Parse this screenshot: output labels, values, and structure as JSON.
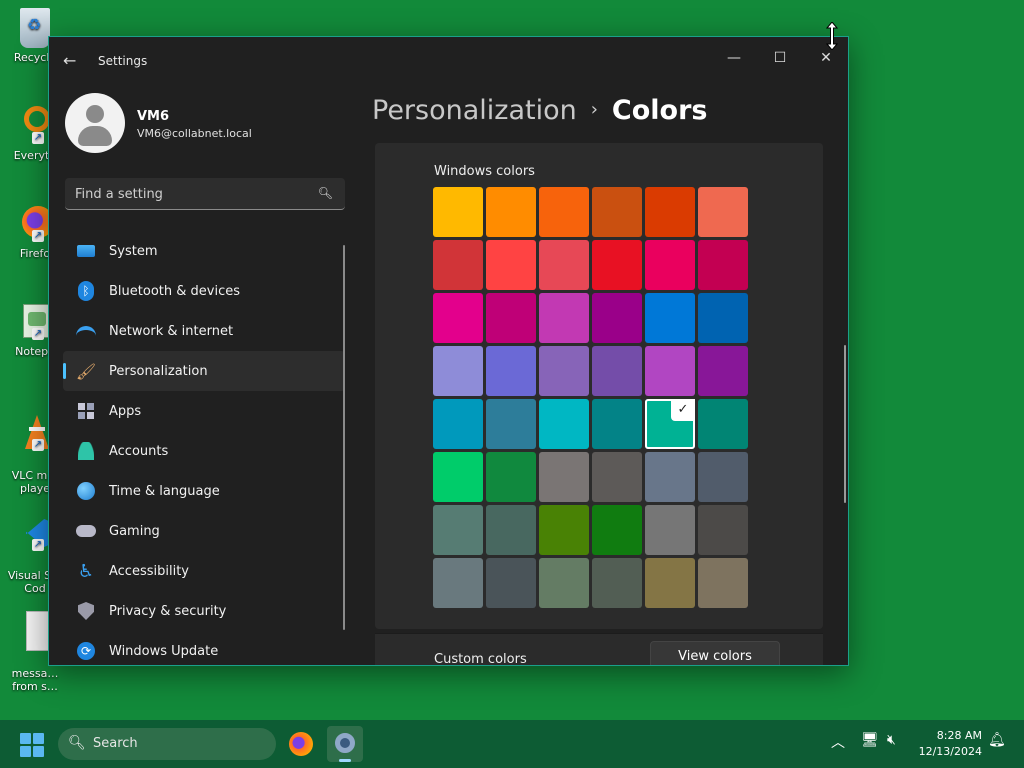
{
  "desktop": {
    "icons": [
      {
        "label": "Recycle"
      },
      {
        "label": "Everyth"
      },
      {
        "label": "Firefo"
      },
      {
        "label": "Notepa"
      },
      {
        "label": "VLC m…\nplaye"
      },
      {
        "label": "Visual S…\nCod"
      },
      {
        "label": "messa…\nfrom s…"
      }
    ]
  },
  "window": {
    "title": "Settings",
    "controls": {
      "minimize": "—",
      "maximize": "☐",
      "close": "✕"
    },
    "profile": {
      "name": "VM6",
      "email": "VM6@collabnet.local"
    },
    "search": {
      "placeholder": "Find a setting"
    },
    "nav": [
      {
        "label": "System",
        "icon": "system-icon"
      },
      {
        "label": "Bluetooth & devices",
        "icon": "bluetooth-icon"
      },
      {
        "label": "Network & internet",
        "icon": "wifi-icon"
      },
      {
        "label": "Personalization",
        "icon": "brush-icon",
        "active": true
      },
      {
        "label": "Apps",
        "icon": "apps-icon"
      },
      {
        "label": "Accounts",
        "icon": "accounts-icon"
      },
      {
        "label": "Time & language",
        "icon": "globe-icon"
      },
      {
        "label": "Gaming",
        "icon": "gamepad-icon"
      },
      {
        "label": "Accessibility",
        "icon": "accessibility-icon"
      },
      {
        "label": "Privacy & security",
        "icon": "shield-icon"
      },
      {
        "label": "Windows Update",
        "icon": "update-icon"
      }
    ],
    "breadcrumb": {
      "parent": "Personalization",
      "separator": "›",
      "current": "Colors"
    },
    "windows_colors": {
      "title": "Windows colors",
      "selected_index": 28,
      "swatches": [
        "#ffb900",
        "#ff8c00",
        "#f7630c",
        "#ca5010",
        "#da3b01",
        "#ef6950",
        "#d13438",
        "#ff4343",
        "#e74856",
        "#e81123",
        "#ea005e",
        "#c30052",
        "#e3008c",
        "#bf0077",
        "#c239b3",
        "#9a0089",
        "#0078d7",
        "#0063b1",
        "#8e8cd8",
        "#6b69d6",
        "#8764b8",
        "#744da9",
        "#b146c2",
        "#881798",
        "#0099bc",
        "#2d7d9a",
        "#00b7c3",
        "#038387",
        "#00b294",
        "#018574",
        "#00cc6a",
        "#10893e",
        "#7a7574",
        "#5d5a58",
        "#68768a",
        "#515c6b",
        "#567c73",
        "#486860",
        "#498205",
        "#107c10",
        "#767676",
        "#4c4a48",
        "#69797e",
        "#4a5459",
        "#647c64",
        "#525e54",
        "#847545",
        "#7e735f"
      ]
    },
    "custom_colors": {
      "label": "Custom colors",
      "button": "View colors"
    }
  },
  "taskbar": {
    "search_label": "Search",
    "time": "8:28 AM",
    "date": "12/13/2024"
  }
}
